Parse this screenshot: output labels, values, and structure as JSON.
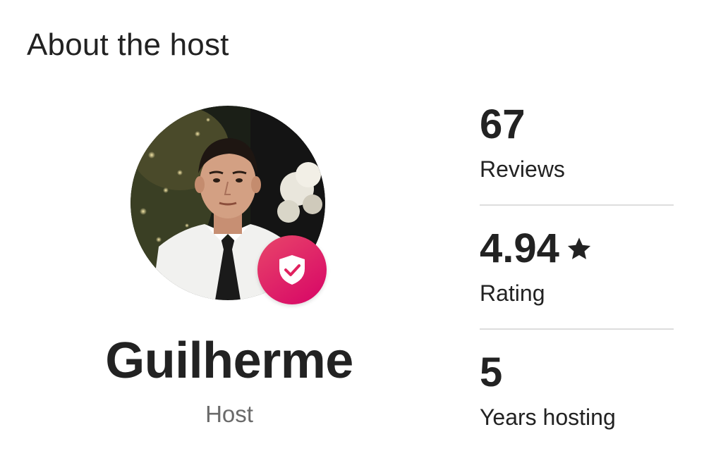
{
  "section_title": "About the host",
  "host": {
    "name": "Guilherme",
    "role": "Host",
    "badge_icon": "shield-check-icon",
    "badge_color": "#E31C5F"
  },
  "stats": [
    {
      "value": "67",
      "label": "Reviews"
    },
    {
      "value": "4.94",
      "label": "Rating",
      "icon": "star-icon"
    },
    {
      "value": "5",
      "label": "Years hosting"
    }
  ]
}
